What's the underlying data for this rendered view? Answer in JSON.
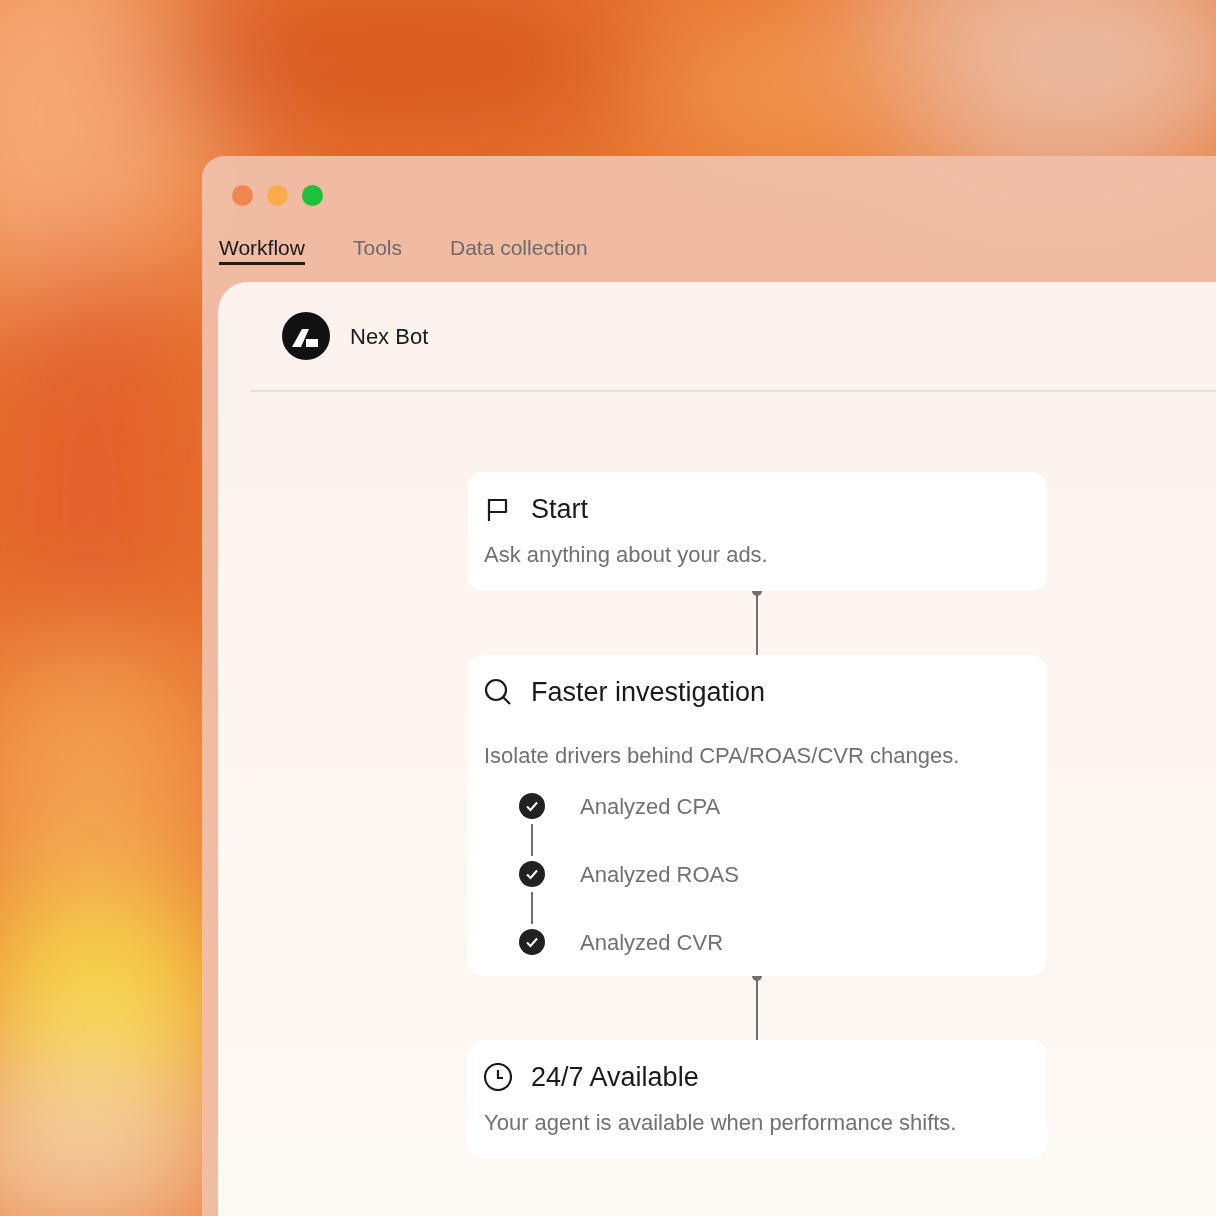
{
  "window": {
    "controls": [
      {
        "color": "#f08550"
      },
      {
        "color": "#fbab4a"
      },
      {
        "color": "#1fc03b"
      }
    ]
  },
  "tabs": [
    {
      "label": "Workflow",
      "selected": true
    },
    {
      "label": "Tools",
      "selected": false
    },
    {
      "label": "Data collection",
      "selected": false
    }
  ],
  "bot": {
    "name": "Nex Bot"
  },
  "workflow": [
    {
      "kind": "trigger",
      "title": "Start",
      "description": "Ask anything about your ads."
    },
    {
      "kind": "analysis",
      "title": "Faster investigation",
      "description": "Isolate drivers behind CPA/ROAS/CVR changes.",
      "steps": [
        {
          "label": "Analyzed CPA",
          "checked": true
        },
        {
          "label": "Analyzed ROAS",
          "checked": true
        },
        {
          "label": "Analyzed CVR",
          "checked": true
        }
      ]
    },
    {
      "kind": "availability",
      "title": "24/7 Available",
      "description": "Your agent is available when performance shifts."
    }
  ]
}
